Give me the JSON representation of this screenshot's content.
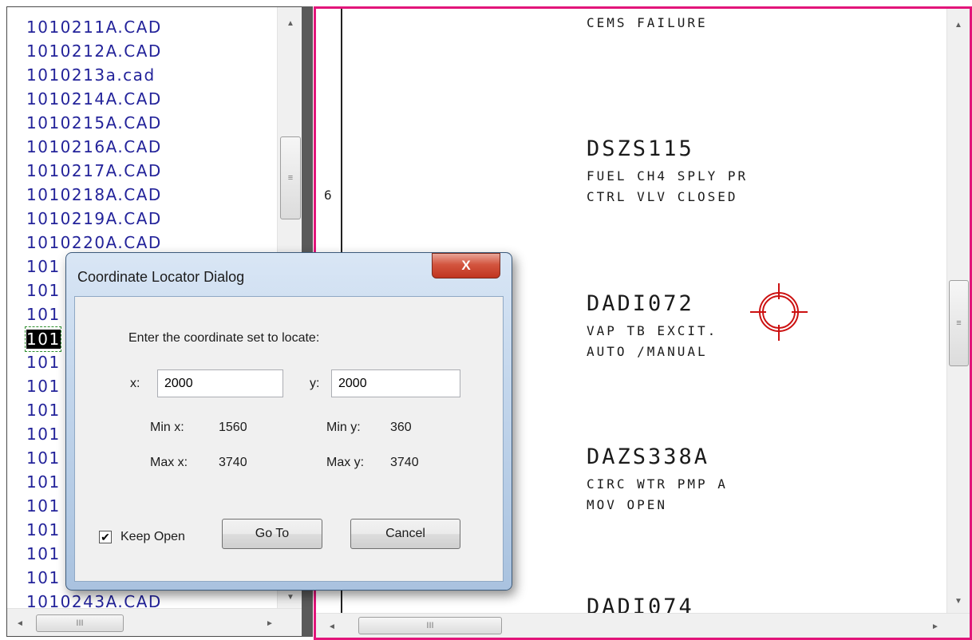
{
  "file_list": {
    "items": [
      "1010211A.CAD",
      "1010212A.CAD",
      "1010213a.cad",
      "1010214A.CAD",
      "1010215A.CAD",
      "1010216A.CAD",
      "1010217A.CAD",
      "1010218A.CAD",
      "1010219A.CAD",
      "1010220A.CAD",
      "101",
      "101",
      "101",
      "101",
      "101",
      "101",
      "101",
      "101",
      "101",
      "101",
      "101",
      "101",
      "101",
      "101",
      "1010243A.CAD"
    ],
    "selected_index": 13
  },
  "drawing": {
    "row_marker": "6",
    "blocks": [
      {
        "tag": "",
        "lines": [
          "CEMS FAILURE"
        ]
      },
      {
        "tag": "DSZS115",
        "lines": [
          "FUEL CH4 SPLY PR",
          "CTRL VLV CLOSED"
        ]
      },
      {
        "tag": "DADI072",
        "lines": [
          "VAP TB EXCIT.",
          "AUTO /MANUAL"
        ]
      },
      {
        "tag": "DAZS338A",
        "lines": [
          "CIRC WTR PMP A",
          "MOV OPEN"
        ]
      },
      {
        "tag": "DADI074",
        "lines": []
      }
    ]
  },
  "dialog": {
    "title": "Coordinate Locator Dialog",
    "close_label": "X",
    "prompt": "Enter the coordinate set to locate:",
    "x_label": "x:",
    "y_label": "y:",
    "x_value": "2000",
    "y_value": "2000",
    "min_x_label": "Min x:",
    "min_x_value": "1560",
    "max_x_label": "Max x:",
    "max_x_value": "3740",
    "min_y_label": "Min y:",
    "min_y_value": "360",
    "max_y_label": "Max y:",
    "max_y_value": "3740",
    "keep_open_label": "Keep Open",
    "keep_open_checked": true,
    "goto_label": "Go To",
    "cancel_label": "Cancel"
  },
  "scroll": {
    "up_arrow": "▲",
    "down_arrow": "▼",
    "left_arrow": "◄",
    "right_arrow": "►",
    "thumb_grip_v": "≡",
    "thumb_grip_h": "III"
  },
  "colors": {
    "file_text": "#23239a",
    "pane_border": "#e2157a",
    "crosshair": "#cc1111"
  }
}
